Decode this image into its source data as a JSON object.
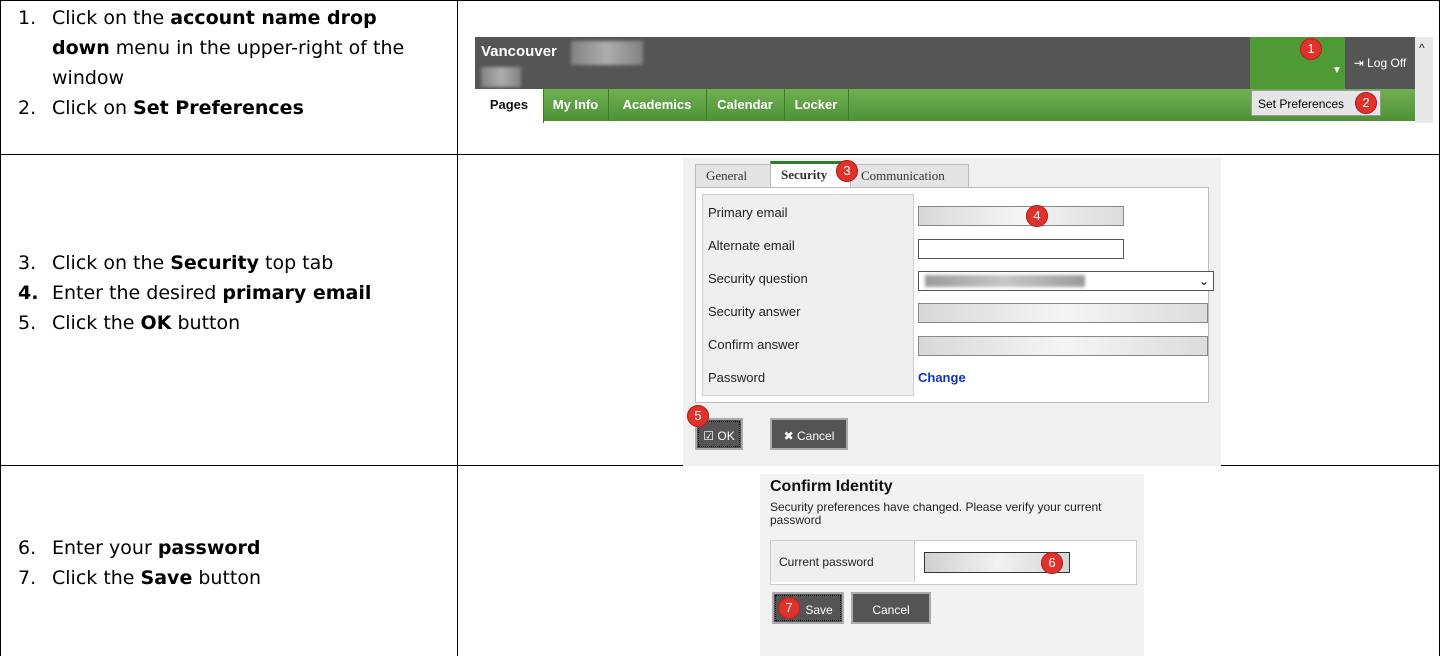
{
  "rows": [
    {
      "steps": [
        {
          "num": "1.",
          "parts": [
            "Click on the ",
            "account name drop down",
            " menu in the upper-right of the window"
          ]
        },
        {
          "num": "2.",
          "parts": [
            "Click on ",
            "Set Preferences",
            ""
          ]
        }
      ]
    },
    {
      "steps": [
        {
          "num": "3.",
          "parts": [
            "Click on the ",
            "Security",
            " top tab"
          ]
        },
        {
          "num": "4.",
          "parts": [
            "Enter the desired ",
            "primary email",
            ""
          ]
        },
        {
          "num": "5.",
          "parts": [
            "Click the ",
            "OK",
            " button"
          ]
        }
      ]
    },
    {
      "steps": [
        {
          "num": "6.",
          "parts": [
            "Enter your ",
            "password",
            ""
          ]
        },
        {
          "num": "7.",
          "parts": [
            "Click the ",
            "Save",
            " button"
          ]
        }
      ]
    }
  ],
  "shot1": {
    "school": "Vancouver",
    "tabs": [
      "Pages",
      "My Info",
      "Academics",
      "Calendar",
      "Locker"
    ],
    "logoff": "Log Off",
    "set_preferences": "Set Preferences",
    "badge1": "1",
    "badge2": "2"
  },
  "shot2": {
    "tabs": [
      "General",
      "Security",
      "Communication"
    ],
    "fields": [
      "Primary email",
      "Alternate email",
      "Security question",
      "Security answer",
      "Confirm answer",
      "Password"
    ],
    "password_link": "Change",
    "ok": "OK",
    "cancel": "Cancel",
    "badge3": "3",
    "badge4": "4",
    "badge5": "5"
  },
  "shot3": {
    "title": "Confirm Identity",
    "message": "Security preferences have changed. Please verify your current password",
    "field": "Current password",
    "save": "Save",
    "cancel": "Cancel",
    "badge6": "6",
    "badge7": "7"
  },
  "colors": {
    "badge": "#e0322b",
    "tabbar_green": "#5aa03e",
    "header_dark": "#555555",
    "link_blue": "#1133bb"
  },
  "icons": {
    "logoff": "logoff-icon",
    "dropdown": "caret-down-icon",
    "ok": "checkbox-icon",
    "cancel": "x-icon"
  }
}
